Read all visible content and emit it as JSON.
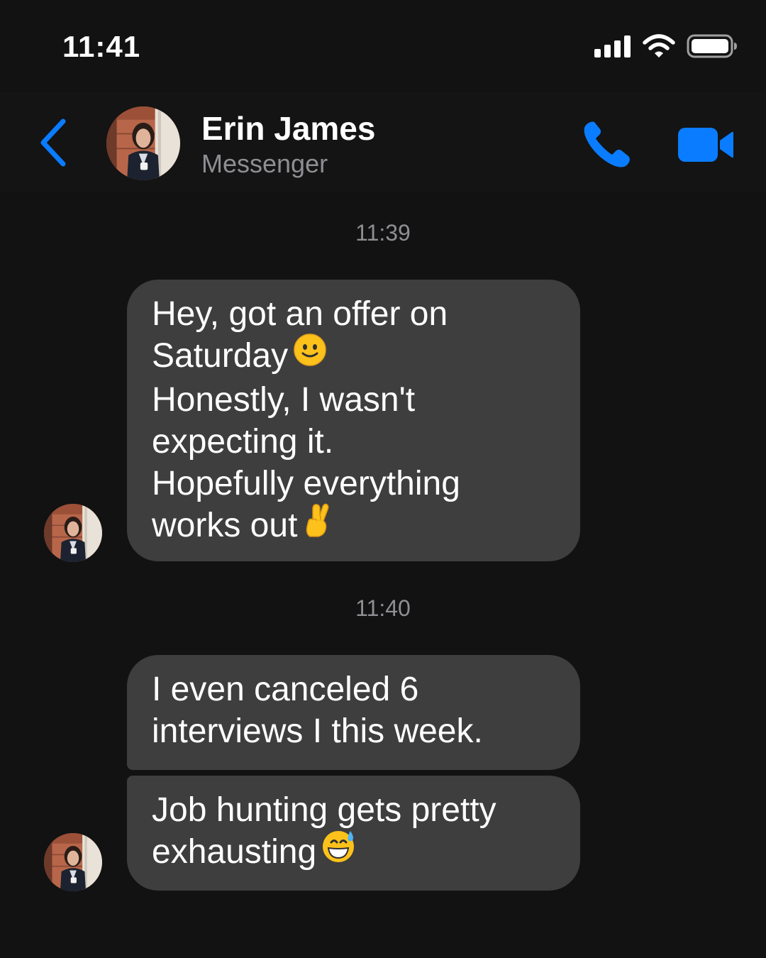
{
  "status_bar": {
    "time": "11:41",
    "icons": [
      "cellular-signal-icon",
      "wifi-icon",
      "battery-icon"
    ]
  },
  "header": {
    "back_icon": "chevron-left-icon",
    "contact_name": "Erin James",
    "subtitle": "Messenger",
    "call_icon": "phone-icon",
    "video_icon": "video-camera-icon",
    "accent_color": "#0a7cff"
  },
  "conversation": {
    "groups": [
      {
        "timestamp": "11:39",
        "messages": [
          {
            "lines": [
              "Hey, got an offer on",
              "Saturday",
              "Honestly, I wasn't",
              "expecting it.",
              "Hopefully everything",
              "works out"
            ],
            "emojis": [
              "slightly-smiling-face-emoji",
              "crossed-fingers-emoji"
            ]
          }
        ]
      },
      {
        "timestamp": "11:40",
        "messages": [
          {
            "lines": [
              "I even canceled 6",
              "interviews I this week."
            ]
          },
          {
            "lines": [
              "Job hunting gets pretty",
              "exhausting"
            ],
            "emojis": [
              "grinning-face-with-sweat-emoji"
            ]
          }
        ]
      }
    ]
  },
  "colors": {
    "background": "#121212",
    "bubble": "#3e3e3e",
    "muted_text": "#8e8e93"
  }
}
